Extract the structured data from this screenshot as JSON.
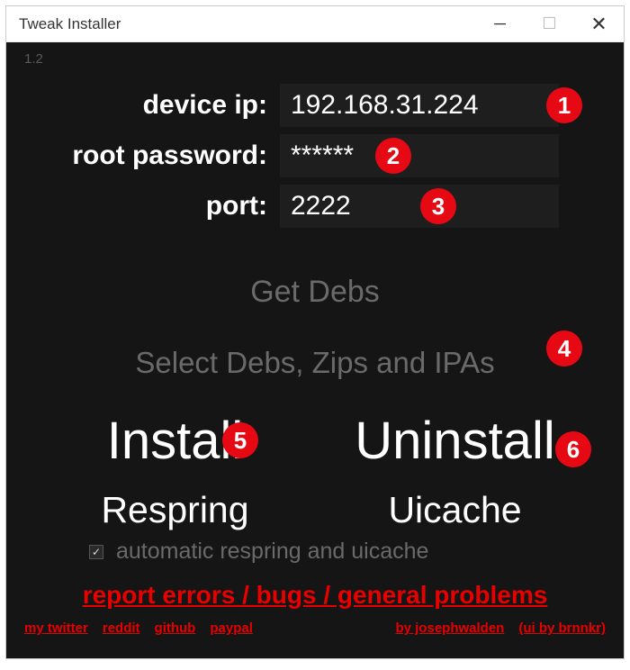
{
  "window": {
    "title": "Tweak Installer"
  },
  "version": "1.2",
  "fields": {
    "device_ip": {
      "label": "device ip:",
      "value": "192.168.31.224"
    },
    "root_password": {
      "label": "root password:",
      "value": "******"
    },
    "port": {
      "label": "port:",
      "value": "2222"
    }
  },
  "buttons": {
    "get_debs": "Get Debs",
    "select_debs": "Select Debs, Zips and IPAs",
    "install": "Install",
    "uninstall": "Uninstall",
    "respring": "Respring",
    "uicache": "Uicache"
  },
  "checkbox": {
    "label": "automatic respring and uicache",
    "checked": true
  },
  "links": {
    "report": "report errors / bugs / general problems",
    "twitter": "my twitter",
    "reddit": "reddit",
    "github": "github",
    "paypal": "paypal",
    "author": "by josephwalden",
    "ui_by": "(ui by brnnkr)"
  },
  "annotations": {
    "b1": "1",
    "b2": "2",
    "b3": "3",
    "b4": "4",
    "b5": "5",
    "b6": "6"
  }
}
